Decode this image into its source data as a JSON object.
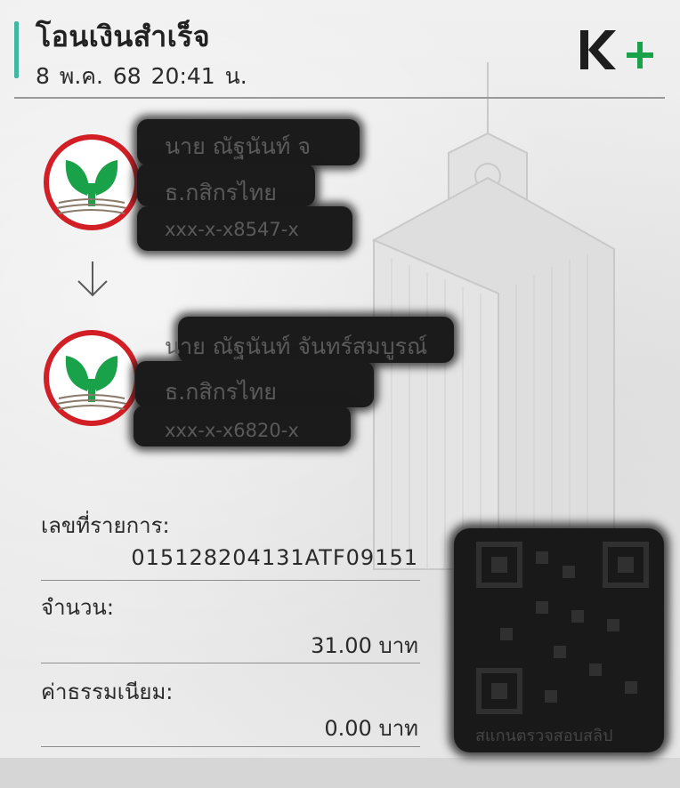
{
  "header": {
    "title": "โอนเงินสำเร็จ",
    "datetime": "8 พ.ค. 68  20:41 น.",
    "brand": {
      "k": "K",
      "plus": "+",
      "color_dark": "#1d1d1d",
      "color_accent": "#1aa24a"
    }
  },
  "sender": {
    "name": "นาย ณัฐนันท์ จ",
    "bank": "ธ.กสิกรไทย",
    "account": "xxx-x-x8547-x",
    "logo": "kbank-logo-icon"
  },
  "transfer_arrow": "arrow-down-icon",
  "receiver": {
    "name": "นาย ณัฐนันท์ จันทร์สมบูรณ์",
    "bank": "ธ.กสิกรไทย",
    "account": "xxx-x-x6820-x",
    "logo": "kbank-logo-icon"
  },
  "details": {
    "ref_label": "เลขที่รายการ:",
    "ref_value": "015128204131ATF09151",
    "amount_label": "จำนวน:",
    "amount_value": "31.00 บาท",
    "fee_label": "ค่าธรรมเนียม:",
    "fee_value": "0.00 บาท"
  },
  "qr": {
    "caption": "สแกนตรวจสอบสลิป",
    "icon": "qr-code-icon"
  },
  "colors": {
    "accent_bar": "#3fb8a2",
    "kbank_green": "#1aa24a",
    "kbank_red": "#d21f26",
    "redaction": "#1b1b1b"
  }
}
